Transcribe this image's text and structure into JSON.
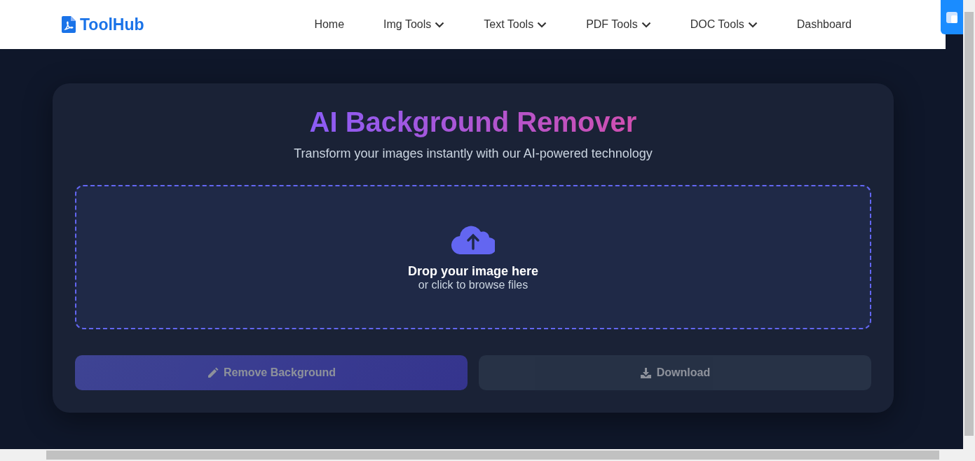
{
  "header": {
    "logo": "ToolHub",
    "nav": [
      {
        "label": "Home",
        "kind": "link"
      },
      {
        "label": "Img Tools",
        "kind": "dropdown"
      },
      {
        "label": "Text Tools",
        "kind": "dropdown"
      },
      {
        "label": "PDF Tools",
        "kind": "dropdown"
      },
      {
        "label": "DOC Tools",
        "kind": "dropdown"
      },
      {
        "label": "Dashboard",
        "kind": "link"
      }
    ]
  },
  "card": {
    "title": "AI Background Remover",
    "subtitle": "Transform your images instantly with our AI-powered technology",
    "dropzone": {
      "heading": "Drop your image here",
      "hint": "or click to browse files"
    },
    "buttons": [
      {
        "label": "Remove Background",
        "kind": "primary",
        "disabled": true
      },
      {
        "label": "Download",
        "kind": "secondary",
        "disabled": true
      }
    ]
  }
}
